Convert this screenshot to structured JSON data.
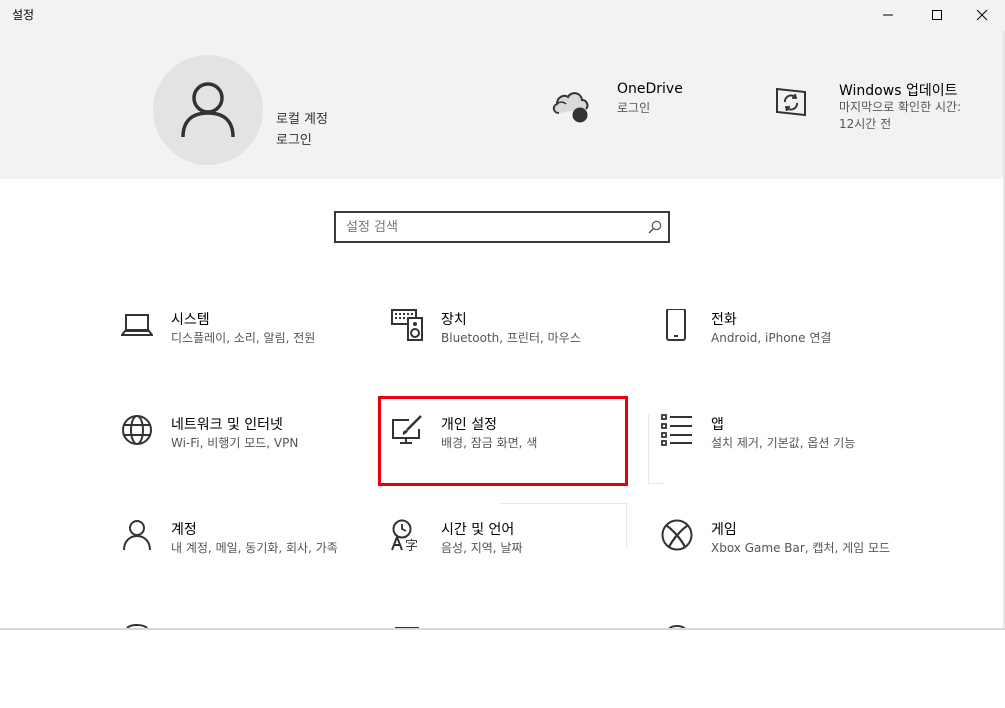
{
  "window": {
    "title": "설정"
  },
  "account": {
    "line1": "로컬 계정",
    "line2": "로그인"
  },
  "onedrive": {
    "title": "OneDrive",
    "subtitle": "로그인"
  },
  "windows_update": {
    "title": "Windows 업데이트",
    "subtitle": "마지막으로 확인한 시간: 12시간 전"
  },
  "search": {
    "placeholder": "설정 검색"
  },
  "tiles": [
    {
      "title": "시스템",
      "subtitle": "디스플레이, 소리, 알림, 전원",
      "icon": "laptop-icon"
    },
    {
      "title": "장치",
      "subtitle": "Bluetooth, 프린터, 마우스",
      "icon": "keyboard-speaker-icon"
    },
    {
      "title": "전화",
      "subtitle": "Android, iPhone 연결",
      "icon": "phone-icon"
    },
    {
      "title": "네트워크 및 인터넷",
      "subtitle": "Wi-Fi, 비행기 모드, VPN",
      "icon": "globe-icon"
    },
    {
      "title": "개인 설정",
      "subtitle": "배경, 잠금 화면, 색",
      "icon": "paintbrush-screen-icon"
    },
    {
      "title": "앱",
      "subtitle": "설치 제거, 기본값, 옵션 기능",
      "icon": "app-list-icon"
    },
    {
      "title": "계정",
      "subtitle": "내 계정, 메일, 동기화, 회사, 가족",
      "icon": "person-icon"
    },
    {
      "title": "시간 및 언어",
      "subtitle": "음성, 지역, 날짜",
      "icon": "time-language-icon"
    },
    {
      "title": "게임",
      "subtitle": "Xbox Game Bar, 캡처, 게임 모드",
      "icon": "xbox-icon"
    }
  ],
  "colors": {
    "header_bg": "#f2f2f2",
    "highlight_border": "#e8000c"
  }
}
